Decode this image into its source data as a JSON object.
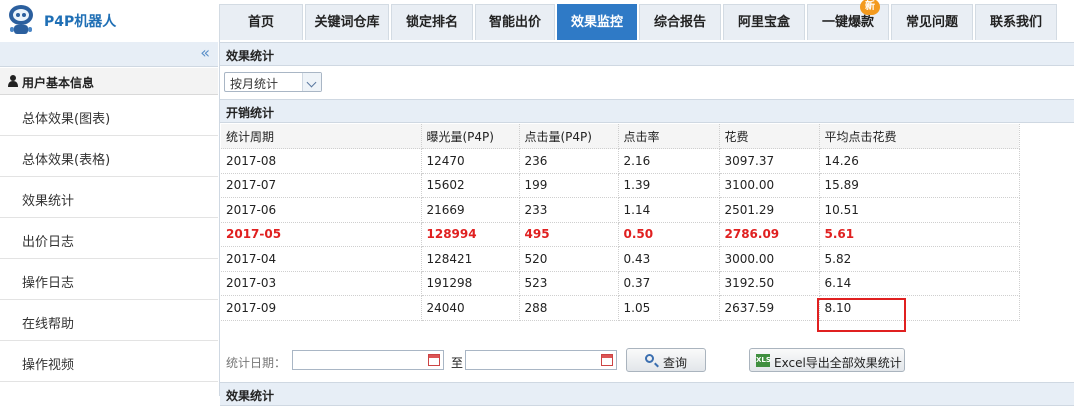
{
  "app": {
    "logo_text": "P4P机器人"
  },
  "nav": [
    {
      "label": "首页"
    },
    {
      "label": "关键词仓库"
    },
    {
      "label": "锁定排名"
    },
    {
      "label": "智能出价"
    },
    {
      "label": "效果监控",
      "active": true
    },
    {
      "label": "综合报告"
    },
    {
      "label": "阿里宝盒"
    },
    {
      "label": "一键爆款",
      "badge": "新"
    },
    {
      "label": "常见问题"
    },
    {
      "label": "联系我们"
    }
  ],
  "sidebar": {
    "collapse_glyph": "«",
    "section_title": "用户基本信息",
    "items": [
      {
        "label": "总体效果(图表)"
      },
      {
        "label": "总体效果(表格)"
      },
      {
        "label": "效果统计"
      },
      {
        "label": "出价日志"
      },
      {
        "label": "操作日志"
      },
      {
        "label": "在线帮助"
      },
      {
        "label": "操作视频"
      }
    ]
  },
  "main": {
    "section_title": "效果统计",
    "period_select": "按月统计",
    "table_title": "开销统计",
    "columns": [
      "统计周期",
      "曝光量(P4P)",
      "点击量(P4P)",
      "点击率",
      "花费",
      "平均点击花费"
    ],
    "rows": [
      [
        "2017-08",
        "12470",
        "236",
        "2.16",
        "3097.37",
        "14.26"
      ],
      [
        "2017-07",
        "15602",
        "199",
        "1.39",
        "3100.00",
        "15.89"
      ],
      [
        "2017-06",
        "21669",
        "233",
        "1.14",
        "2501.29",
        "10.51"
      ],
      [
        "2017-05",
        "128994",
        "495",
        "0.50",
        "2786.09",
        "5.61"
      ],
      [
        "2017-04",
        "128421",
        "520",
        "0.43",
        "3000.00",
        "5.82"
      ],
      [
        "2017-03",
        "191298",
        "523",
        "0.37",
        "3192.50",
        "6.14"
      ],
      [
        "2017-09",
        "24040",
        "288",
        "1.05",
        "2637.59",
        "8.10"
      ]
    ],
    "highlight_row": "2017-05",
    "filter": {
      "date_label": "统计日期：",
      "to_label": "至",
      "start_date": "",
      "end_date": "",
      "search_button": "查询",
      "export_button": "Excel导出全部效果统计"
    },
    "next_section_title": "效果统计"
  },
  "colors": {
    "nav_active": "#2f7ac6",
    "highlight_text": "#e02020",
    "annotation_box": "#e02020"
  }
}
